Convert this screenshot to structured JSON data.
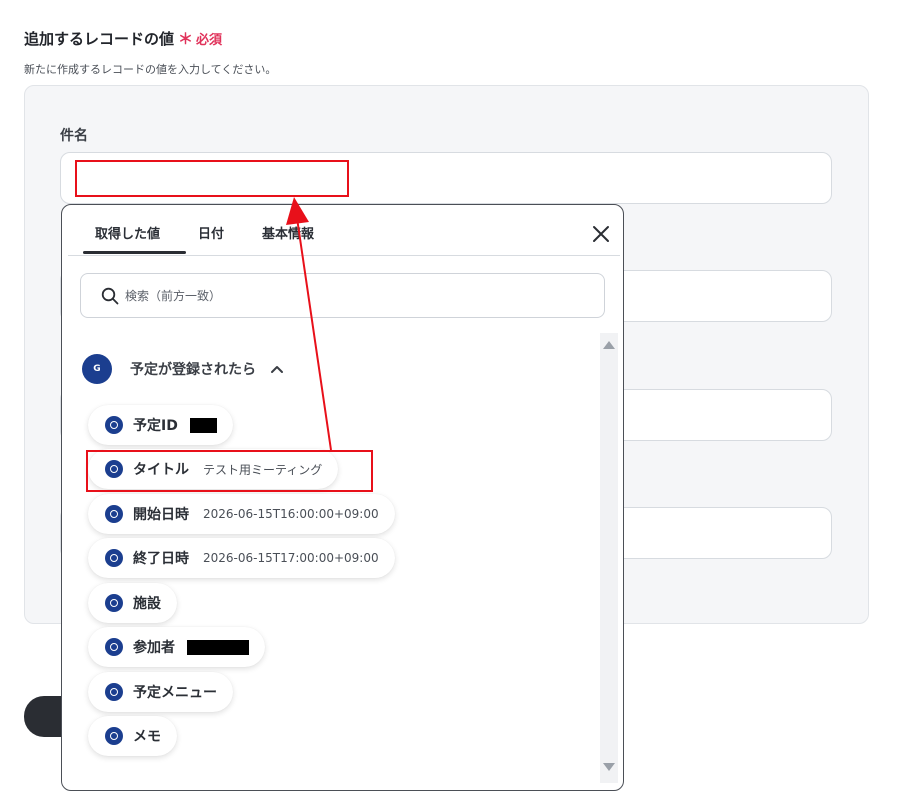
{
  "section": {
    "title": "追加するレコードの値",
    "required_mark": "＊",
    "required_label": "必須",
    "description": "新たに作成するレコードの値を入力してください。"
  },
  "fields": [
    {
      "label": "件名",
      "value": ""
    }
  ],
  "popup": {
    "tabs": [
      {
        "label": "取得した値",
        "active": true
      },
      {
        "label": "日付",
        "active": false
      },
      {
        "label": "基本情報",
        "active": false
      }
    ],
    "close_icon": "close-icon",
    "search": {
      "placeholder": "検索（前方一致）",
      "value": ""
    },
    "group": {
      "title": "予定が登録されたら",
      "logo_text": "G",
      "expanded": true
    },
    "items": [
      {
        "label": "予定ID",
        "value": "",
        "redacted": true
      },
      {
        "label": "タイトル",
        "value": "テスト用ミーティング",
        "redacted": false
      },
      {
        "label": "開始日時",
        "value": "2026-06-15T16:00:00+09:00",
        "redacted": false
      },
      {
        "label": "終了日時",
        "value": "2026-06-15T17:00:00+09:00",
        "redacted": false
      },
      {
        "label": "施設",
        "value": "",
        "redacted": false
      },
      {
        "label": "参加者",
        "value": "",
        "redacted": true
      },
      {
        "label": "予定メニュー",
        "value": "",
        "redacted": false
      },
      {
        "label": "メモ",
        "value": "",
        "redacted": false
      }
    ]
  },
  "colors": {
    "required": "#e0325a",
    "annotation": "#e8101a",
    "brand": "#1b3e8f",
    "panel": "#f5f6f8"
  }
}
